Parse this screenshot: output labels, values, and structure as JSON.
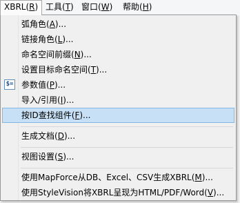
{
  "menubar": {
    "items": [
      {
        "label": "XBRL(R)",
        "active": true
      },
      {
        "label": "工具(T)",
        "active": false
      },
      {
        "label": "窗口(W)",
        "active": false
      },
      {
        "label": "帮助(H)",
        "active": false
      }
    ]
  },
  "dropdown": {
    "items": [
      {
        "label": "弧角色(A)..."
      },
      {
        "label": "链接角色(L)..."
      },
      {
        "label": "命名空间前缀(N)..."
      },
      {
        "label": "设置目标命名空间(T)..."
      },
      {
        "label": "参数值(P)...",
        "icon": "parameter-icon",
        "icon_text": "$="
      },
      {
        "label": "导入/引用(I)..."
      },
      {
        "label": "按ID查找组件(F)...",
        "highlighted": true
      },
      {
        "label": "生成文档(D)..."
      },
      {
        "label": "视图设置(S)..."
      },
      {
        "label": "使用MapForce从DB、Excel、CSV生成XBRL(M)..."
      },
      {
        "label": "使用StyleVision将XBRL呈现为HTML/PDF/Word(V)..."
      }
    ]
  },
  "colors": {
    "highlight_fill": "#c7e0f6",
    "highlight_border": "#82b6e4",
    "menu_background": "#f0f0f0"
  }
}
